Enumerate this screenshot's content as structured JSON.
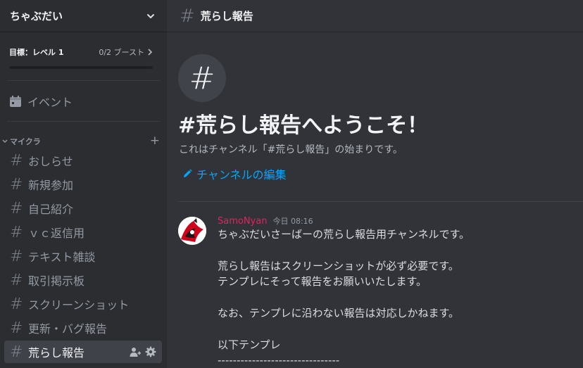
{
  "server": {
    "name": "ちゃぶだい"
  },
  "boost": {
    "goal": "目標：レベル 1",
    "count": "0/2 ブースト",
    "progress": 0
  },
  "events": {
    "label": "イベント"
  },
  "category": {
    "name": "マイクラ"
  },
  "channels": [
    {
      "label": "おしらせ"
    },
    {
      "label": "新規参加"
    },
    {
      "label": "自己紹介"
    },
    {
      "label": "ｖｃ返信用"
    },
    {
      "label": "テキスト雑談"
    },
    {
      "label": "取引掲示板"
    },
    {
      "label": "スクリーンショット"
    },
    {
      "label": "更新・バグ報告"
    },
    {
      "label": "荒らし報告",
      "active": true
    }
  ],
  "topbar": {
    "title": "荒らし報告"
  },
  "welcome": {
    "title": "#荒らし報告へようこそ！",
    "subtitle": "これはチャンネル「#荒らし報告」の始まりです。",
    "edit_link": "チャンネルの編集"
  },
  "message": {
    "author": "SamoNyan",
    "timestamp": "今日 08:16",
    "lines": [
      "ちゃぶだいさーばーの荒らし報告用チャンネルです。",
      "",
      "荒らし報告はスクリーンショットが必ず必要です。",
      "テンプレにそって報告をお願いいたします。",
      "",
      "なお、テンプレに沿わない報告は対応しかねます。",
      "",
      "以下テンプレ",
      "--------------------------------"
    ]
  },
  "colors": {
    "accent_link": "#00a8fc",
    "author": "#e0245e"
  }
}
